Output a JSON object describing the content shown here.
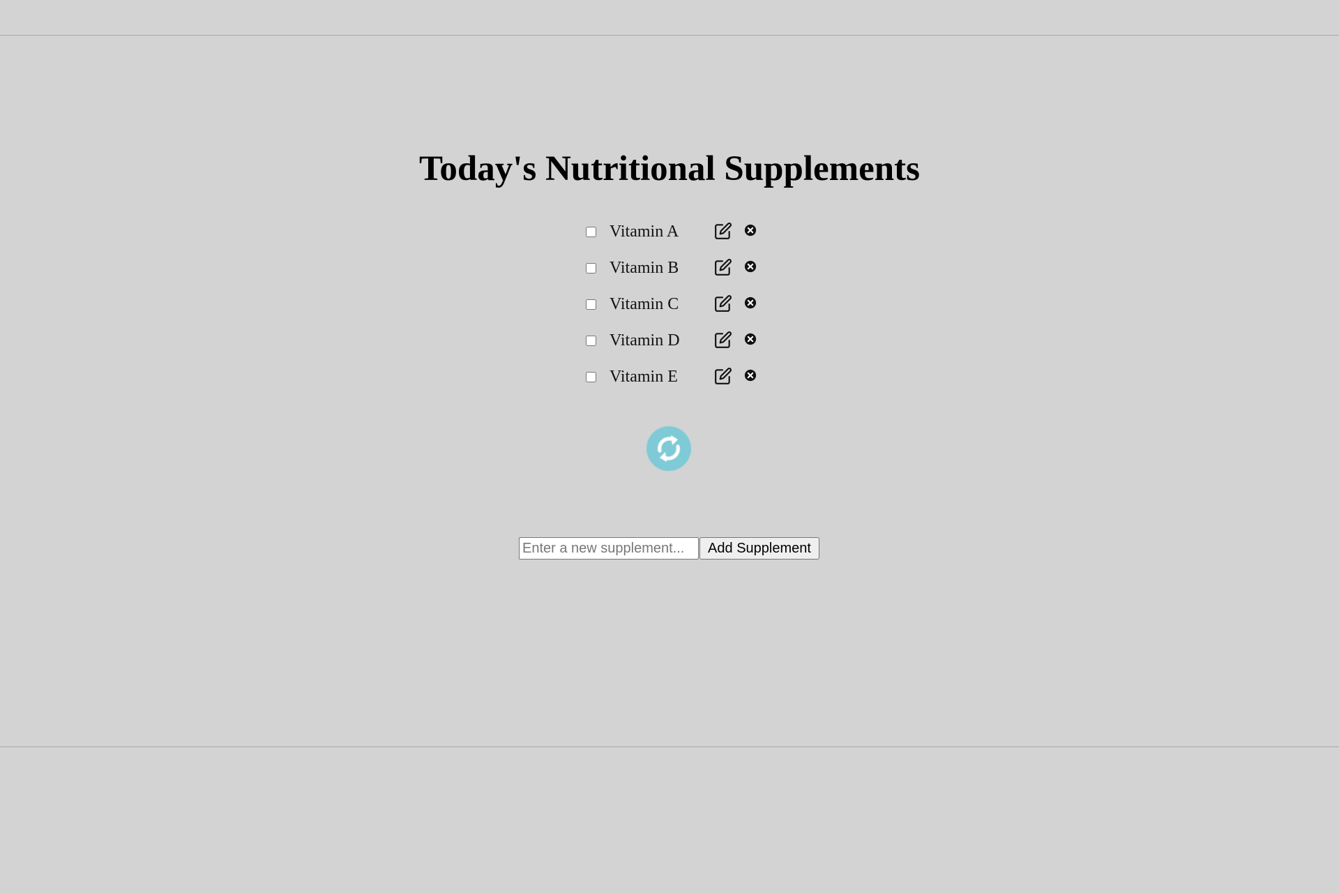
{
  "page": {
    "title": "Today's Nutritional Supplements"
  },
  "supplements": [
    {
      "name": "Vitamin A",
      "checked": false
    },
    {
      "name": "Vitamin B",
      "checked": false
    },
    {
      "name": "Vitamin C",
      "checked": false
    },
    {
      "name": "Vitamin D",
      "checked": false
    },
    {
      "name": "Vitamin E",
      "checked": false
    }
  ],
  "icons": {
    "edit": "edit-icon",
    "delete": "close-circle-icon",
    "refresh": "refresh-icon"
  },
  "colors": {
    "background": "#d3d3d3",
    "refresh_accent": "#7ecad6"
  },
  "add_form": {
    "placeholder": "Enter a new supplement...",
    "value": "",
    "button_label": "Add Supplement"
  }
}
